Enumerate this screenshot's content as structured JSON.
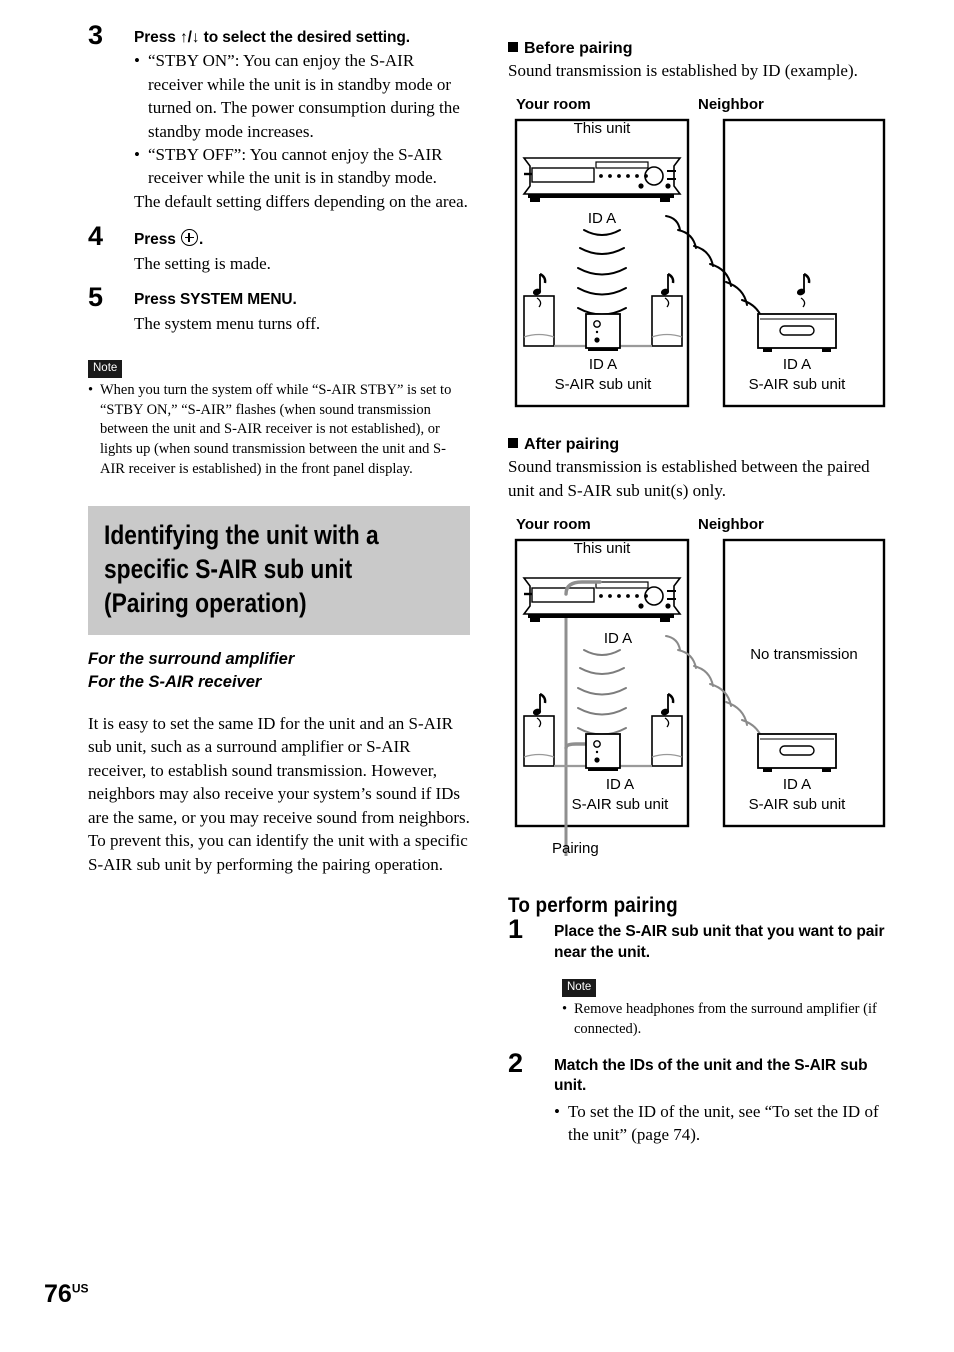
{
  "page": {
    "number": "76",
    "region": "US"
  },
  "left_column": {
    "steps": [
      {
        "number": "3",
        "title": "Press ↑/↓ to select the desired setting.",
        "bullets": [
          "“STBY ON”: You can enjoy the S-AIR receiver while the unit is in standby mode or turned on. The power consumption during the standby mode increases.",
          "“STBY OFF”: You cannot enjoy the S-AIR receiver while the unit is in standby mode."
        ],
        "after": "The default setting differs depending on the area."
      },
      {
        "number": "4",
        "title_prefix": "Press",
        "title_suffix": ".",
        "icon": "circle-plus-icon",
        "body": "The setting is made."
      },
      {
        "number": "5",
        "title": "Press SYSTEM MENU.",
        "body": "The system menu turns off."
      }
    ],
    "note": {
      "badge": "Note",
      "items": [
        "When you turn the system off while “S-AIR STBY” is set to “STBY ON,” “S-AIR” flashes (when sound transmission between the unit and S-AIR receiver is not established), or lights up (when sound transmission between the unit and S-AIR receiver is established) in the front panel display."
      ]
    },
    "section": {
      "heading": "Identifying the unit with a specific S-AIR sub unit (Pairing operation)",
      "band_color": "#c9c9c9",
      "subheads": [
        "For the surround amplifier",
        "For the S-AIR receiver"
      ],
      "paragraph": "It is easy to set the same ID for the unit and an S-AIR sub unit, such as a surround amplifier or S-AIR receiver, to establish sound transmission. However, neighbors may also receive your system’s sound if IDs are the same, or you may receive sound from neighbors. To prevent this, you can identify the unit with a specific S-AIR sub unit by performing the pairing operation."
    }
  },
  "right_column": {
    "before_pairing": {
      "heading": "Before pairing",
      "intro": "Sound transmission is established by ID (example).",
      "diagram": {
        "room_left_label": "Your room",
        "room_right_label": "Neighbor",
        "this_unit_label": "This unit",
        "unit_id": "ID A",
        "sub_unit_id": "ID A",
        "sub_unit_label": "S-AIR sub unit",
        "neighbor_sub_unit_id": "ID A",
        "neighbor_sub_unit_label": "S-AIR sub unit"
      }
    },
    "after_pairing": {
      "heading": "After pairing",
      "intro": "Sound transmission is established between the paired unit and S-AIR sub unit(s) only.",
      "diagram": {
        "room_left_label": "Your room",
        "room_right_label": "Neighbor",
        "this_unit_label": "This unit",
        "unit_id": "ID A",
        "sub_unit_id": "ID A",
        "sub_unit_label": "S-AIR sub unit",
        "neighbor_status": "No transmission",
        "neighbor_sub_unit_id": "ID A",
        "neighbor_sub_unit_label": "S-AIR sub unit",
        "pairing_label": "Pairing"
      }
    },
    "to_perform_pairing": {
      "heading": "To perform pairing",
      "steps": [
        {
          "number": "1",
          "title": "Place the S-AIR sub unit that you want to pair near the unit.",
          "note": {
            "badge": "Note",
            "items": [
              "Remove headphones from the surround amplifier (if connected)."
            ]
          }
        },
        {
          "number": "2",
          "title": "Match the IDs of the unit and the S-AIR sub unit.",
          "bullets": [
            "To set the ID of the unit, see “To set the ID of the unit” (page 74)."
          ]
        }
      ]
    }
  }
}
